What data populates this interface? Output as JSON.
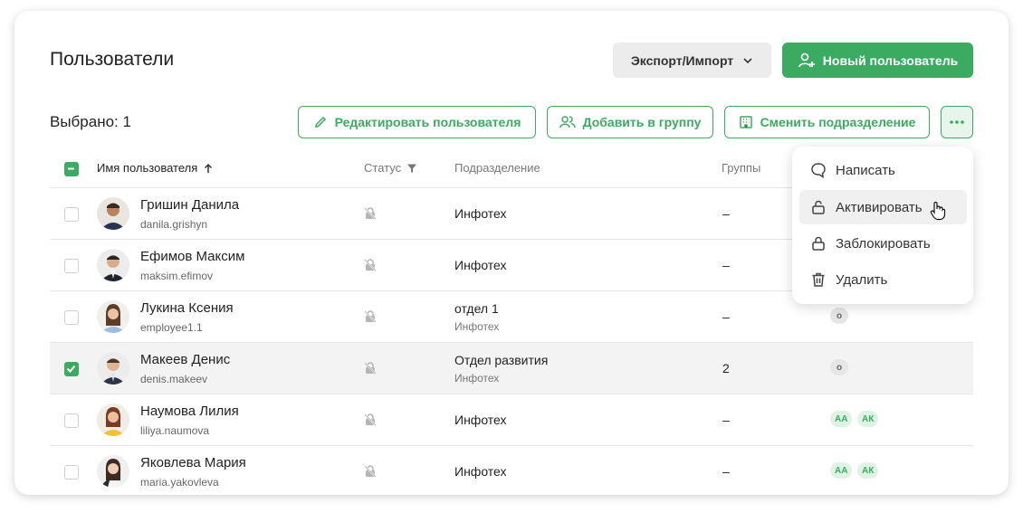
{
  "header": {
    "title": "Пользователи",
    "export_label": "Экспорт/Импорт",
    "new_user_label": "Новый пользователь"
  },
  "toolbar": {
    "selected_label": "Выбрано: 1",
    "edit_label": "Редактировать пользователя",
    "add_group_label": "Добавить в группу",
    "change_dept_label": "Сменить подразделение",
    "more_icon": "more-dots-icon"
  },
  "table": {
    "columns": {
      "name": "Имя пользователя",
      "status": "Статус",
      "department": "Подразделение",
      "groups": "Группы"
    },
    "rows": [
      {
        "name": "Гришин Данила",
        "login": "danila.grishyn",
        "dept": "Инфотех",
        "dept_sub": "",
        "groups": "–",
        "checked": false
      },
      {
        "name": "Ефимов Максим",
        "login": "maksim.efimov",
        "dept": "Инфотех",
        "dept_sub": "",
        "groups": "–",
        "checked": false
      },
      {
        "name": "Лукина Ксения",
        "login": "employee1.1",
        "dept": "отдел 1",
        "dept_sub": "Инфотех",
        "groups": "–",
        "checked": false,
        "badges": [
          "о"
        ]
      },
      {
        "name": "Макеев Денис",
        "login": "denis.makeev",
        "dept": "Отдел развития",
        "dept_sub": "Инфотех",
        "groups": "2",
        "checked": true,
        "badges": [
          "о"
        ]
      },
      {
        "name": "Наумова Лилия",
        "login": "liliya.naumova",
        "dept": "Инфотех",
        "dept_sub": "",
        "groups": "–",
        "checked": false,
        "badges": [
          "АА",
          "АК"
        ]
      },
      {
        "name": "Яковлева Мария",
        "login": "maria.yakovleva",
        "dept": "Инфотех",
        "dept_sub": "",
        "groups": "–",
        "checked": false,
        "badges": [
          "АА",
          "АК"
        ]
      }
    ]
  },
  "menu": {
    "items": [
      {
        "label": "Написать",
        "icon": "chat-bubble-icon"
      },
      {
        "label": "Активировать",
        "icon": "unlock-icon"
      },
      {
        "label": "Заблокировать",
        "icon": "lock-icon"
      },
      {
        "label": "Удалить",
        "icon": "trash-icon"
      }
    ]
  },
  "colors": {
    "accent": "#3aab60",
    "accent_light": "#dff2e4",
    "selected_row": "#f3f3f3"
  }
}
